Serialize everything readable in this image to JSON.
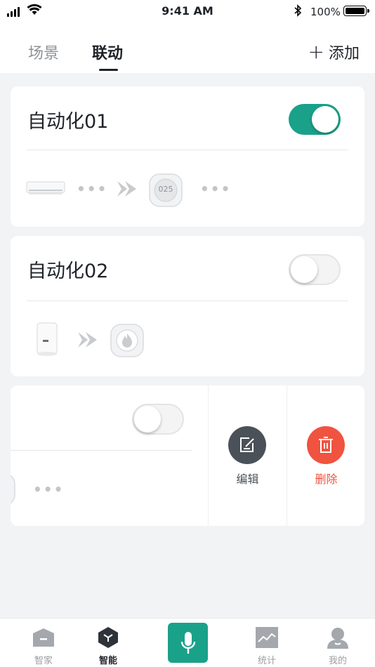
{
  "status_bar": {
    "time": "9:41 AM",
    "battery": "100%"
  },
  "header": {
    "tabs": [
      {
        "label": "场景",
        "active": false
      },
      {
        "label": "联动",
        "active": true
      }
    ],
    "add_label": "添加"
  },
  "cards": [
    {
      "title": "自动化01",
      "enabled": true
    },
    {
      "title": "自动化02",
      "enabled": false
    },
    {
      "title": "",
      "enabled": false
    }
  ],
  "device_labels": {
    "thermostat_reading": "025"
  },
  "swipe_actions": {
    "edit_label": "编辑",
    "delete_label": "删除"
  },
  "tabbar": {
    "items": [
      {
        "label": "智家"
      },
      {
        "label": "智能"
      },
      {
        "label": "统计"
      },
      {
        "label": "我的"
      }
    ]
  },
  "colors": {
    "accent": "#1aa189",
    "delete": "#f0533f",
    "edit": "#4a5159"
  }
}
